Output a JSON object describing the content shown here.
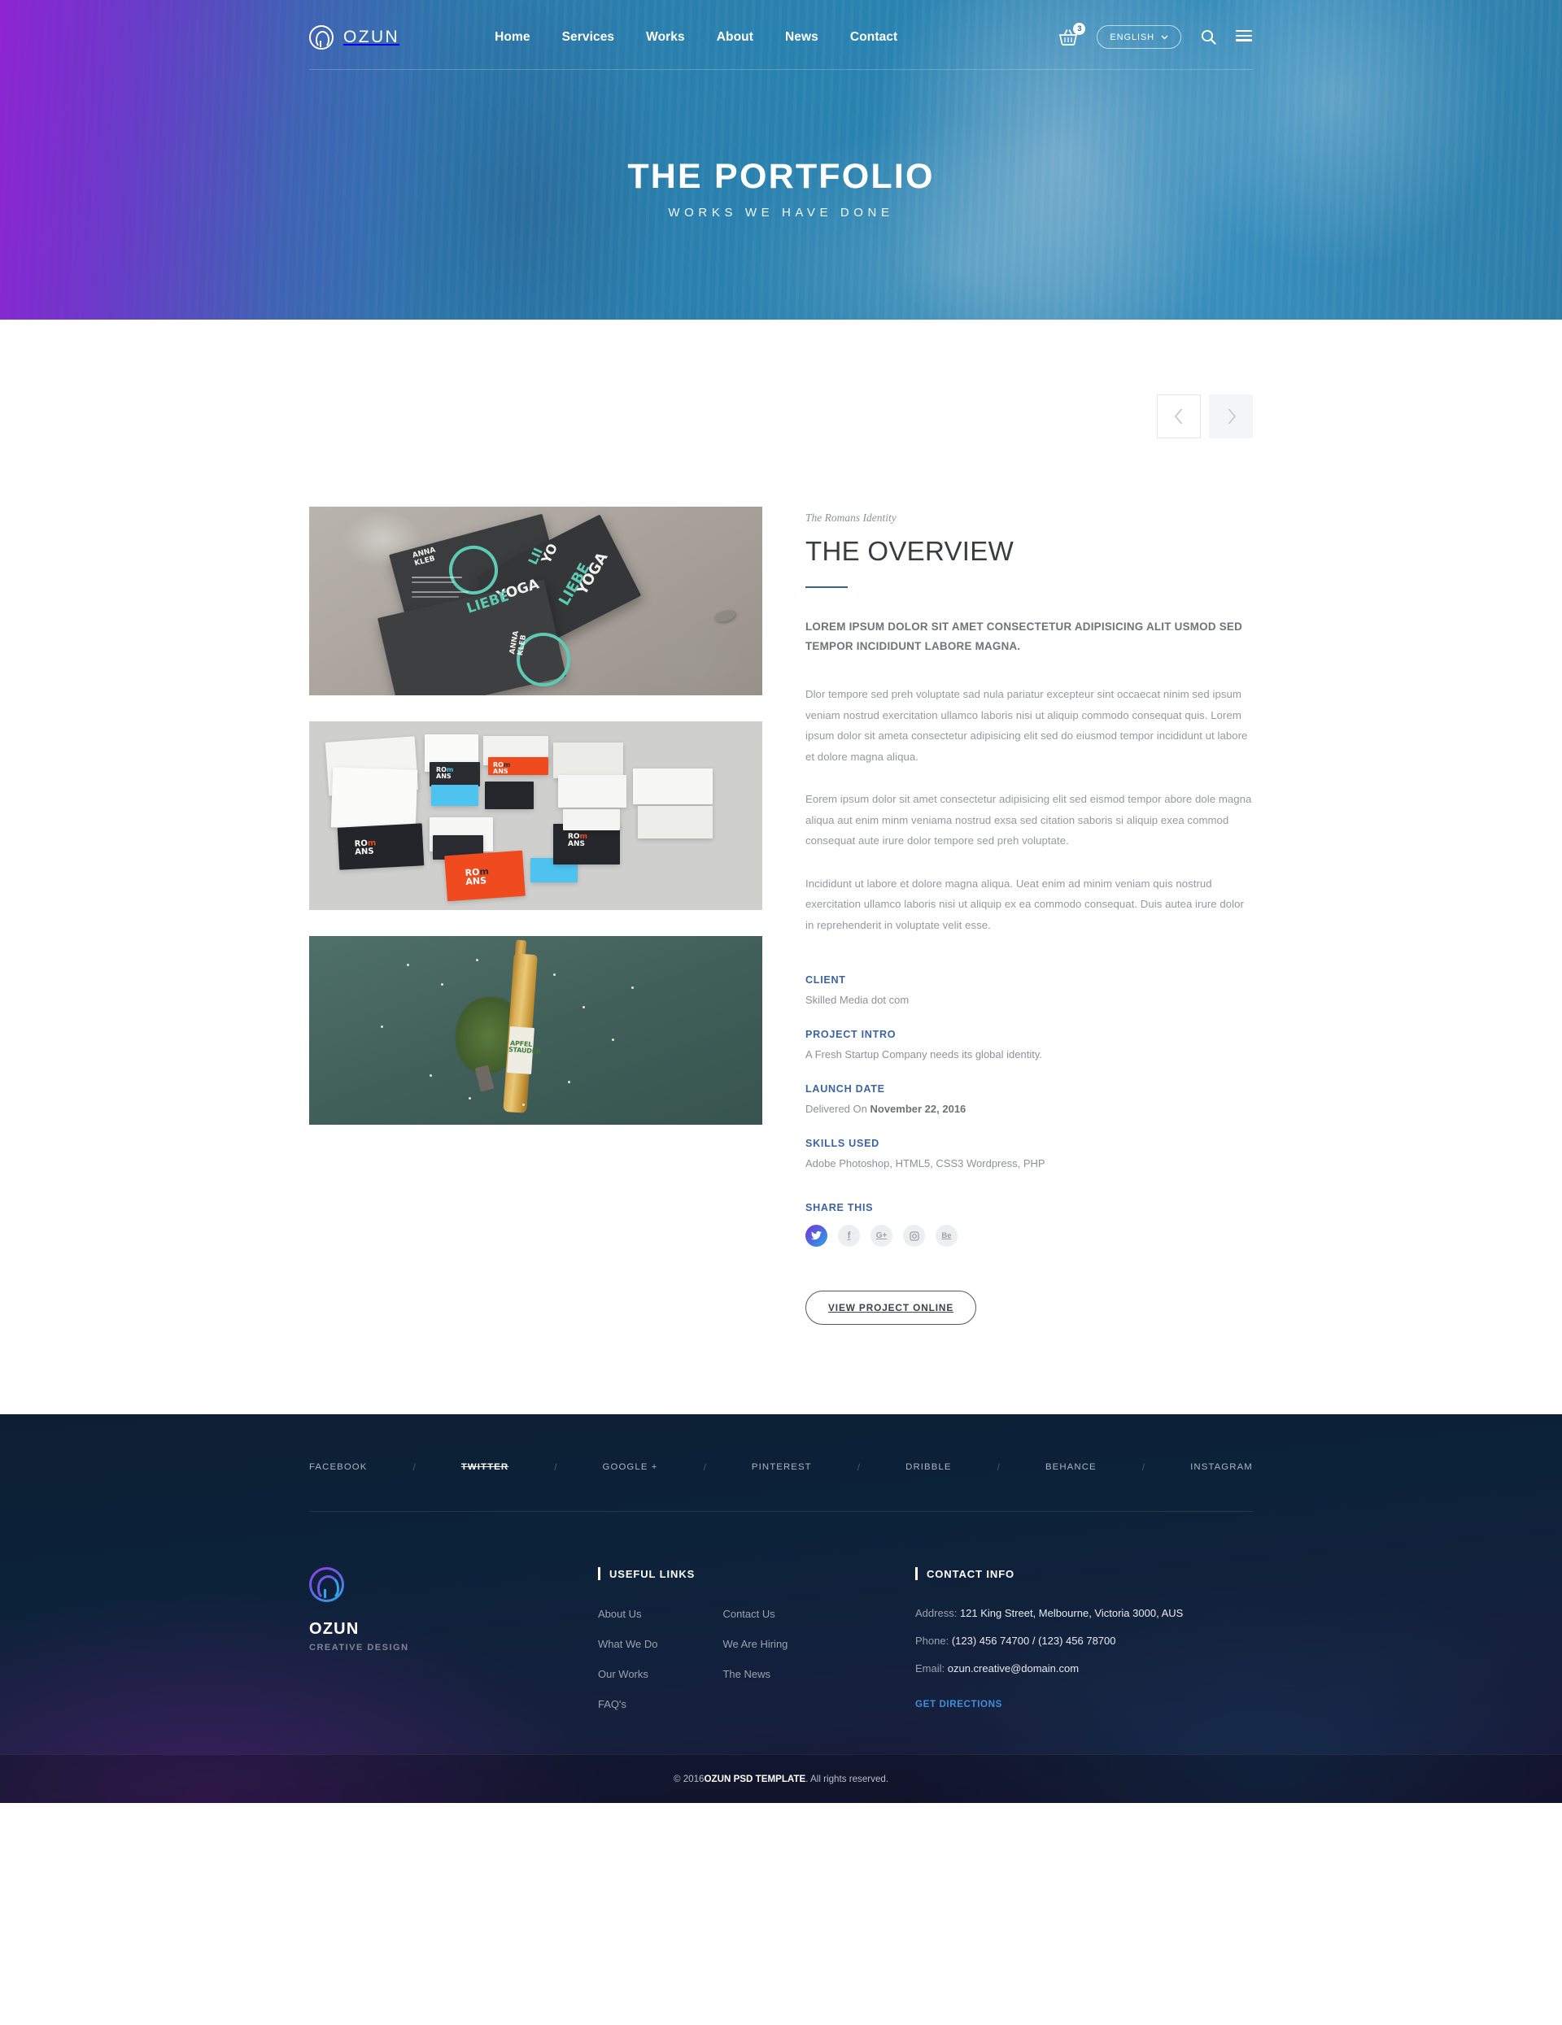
{
  "header": {
    "brand": "OZUN",
    "brand_icon": "ozun-circle-logo-icon",
    "nav": [
      {
        "label": "Home"
      },
      {
        "label": "Services"
      },
      {
        "label": "Works"
      },
      {
        "label": "About"
      },
      {
        "label": "News"
      },
      {
        "label": "Contact"
      }
    ],
    "cart": {
      "icon": "shopping-basket-icon",
      "count": "3"
    },
    "language": {
      "label": "ENGLISH",
      "caret_icon": "chevron-down-icon"
    },
    "search_icon": "search-icon",
    "menu_icon": "hamburger-menu-icon"
  },
  "hero": {
    "title": "THE PORTFOLIO",
    "subtitle": "WORKS WE HAVE DONE"
  },
  "pager": {
    "prev_icon": "chevron-left-icon",
    "next_icon": "chevron-right-icon"
  },
  "gallery": {
    "items": [
      {
        "name": "yoga-liebe-business-cards-photo",
        "alt": "Dark business cards with teal YOGA LIEBE branding on concrete"
      },
      {
        "name": "romans-stationery-flatlay-photo",
        "alt": "Orange, black and cyan ROMANS stationery flat lay"
      },
      {
        "name": "apfel-stauder-bottle-photo",
        "alt": "Apfel Stauder bottle with moss on green background"
      }
    ]
  },
  "overview": {
    "eyebrow": "The Romans Identity",
    "title": "THE OVERVIEW",
    "lead": "Lorem ipsum dolor sit amet consectetur adipisicing alit usmod sed tempor incididunt labore magna.",
    "paragraphs": [
      "Dlor tempore sed preh voluptate sad nula pariatur excepteur sint occaecat ninim sed ipsum veniam nostrud exercitation ullamco laboris nisi ut aliquip commodo consequat quis. Lorem ipsum dolor sit ameta consectetur adipisicing elit sed do eiusmod tempor incididunt ut labore et dolore magna aliqua.",
      "Eorem ipsum dolor sit amet consectetur adipisicing elit sed eismod tempor abore dole magna aliqua aut enim minm veniama nostrud exsa sed citation saboris si aliquip exea commod consequat aute irure dolor tempore sed preh voluptate.",
      "Incididunt ut labore et dolore magna aliqua. Ueat enim ad minim veniam quis nostrud exercitation ullamco laboris nisi ut aliquip ex ea commodo consequat. Duis autea irure dolor in reprehenderit in voluptate velit esse."
    ]
  },
  "meta": {
    "client": {
      "label": "CLIENT",
      "value": "Skilled Media dot com"
    },
    "project_intro": {
      "label": "PROJECT INTRO",
      "value": "A Fresh Startup Company needs its global identity."
    },
    "launch_date": {
      "label": "LAUNCH DATE",
      "prefix": "Delivered On ",
      "value": "November 22, 2016"
    },
    "skills_used": {
      "label": "SKILLS USED",
      "value": "Adobe Photoshop, HTML5, CSS3 Wordpress, PHP"
    }
  },
  "share": {
    "label": "SHARE THIS",
    "buttons": [
      {
        "name": "twitter-icon",
        "glyph": "✓",
        "active": true
      },
      {
        "name": "facebook-icon",
        "glyph": "f",
        "active": false
      },
      {
        "name": "google-plus-icon",
        "glyph": "G+",
        "active": false
      },
      {
        "name": "instagram-icon",
        "glyph": "▣",
        "active": false
      },
      {
        "name": "behance-icon",
        "glyph": "Be",
        "active": false
      }
    ]
  },
  "cta": {
    "view_project": "VIEW PROJECT ONLINE"
  },
  "footer": {
    "social": [
      {
        "label": "FACEBOOK",
        "active": false
      },
      {
        "label": "TWITTER",
        "active": true
      },
      {
        "label": "GOOGLE +",
        "active": false
      },
      {
        "label": "PINTEREST",
        "active": false
      },
      {
        "label": "DRIBBLE",
        "active": false
      },
      {
        "label": "BEHANCE",
        "active": false
      },
      {
        "label": "INSTAGRAM",
        "active": false
      }
    ],
    "separator": "/",
    "brand": {
      "logo_icon": "ozun-circle-logo-icon",
      "name": "OZUN",
      "tagline": "CREATIVE DESIGN"
    },
    "useful_links": {
      "heading": "USEFUL LINKS",
      "column_one": [
        "About Us",
        "What We Do",
        "Our Works",
        "FAQ's"
      ],
      "column_two": [
        "Contact Us",
        "We Are Hiring",
        "The News"
      ]
    },
    "contact": {
      "heading": "CONTACT INFO",
      "address_label": "Address:",
      "address_value": "121 King Street, Melbourne, Victoria 3000, AUS",
      "phone_label": "Phone:",
      "phone_value": "(123) 456 74700   /   (123) 456 78700",
      "email_label": "Email:",
      "email_value": "ozun.creative@domain.com",
      "directions": "GET DIRECTIONS"
    },
    "copyright_pre": "© 2016 ",
    "copyright_brand": "OZUN PSD TEMPLATE",
    "copyright_post": " . All rights reserved."
  }
}
